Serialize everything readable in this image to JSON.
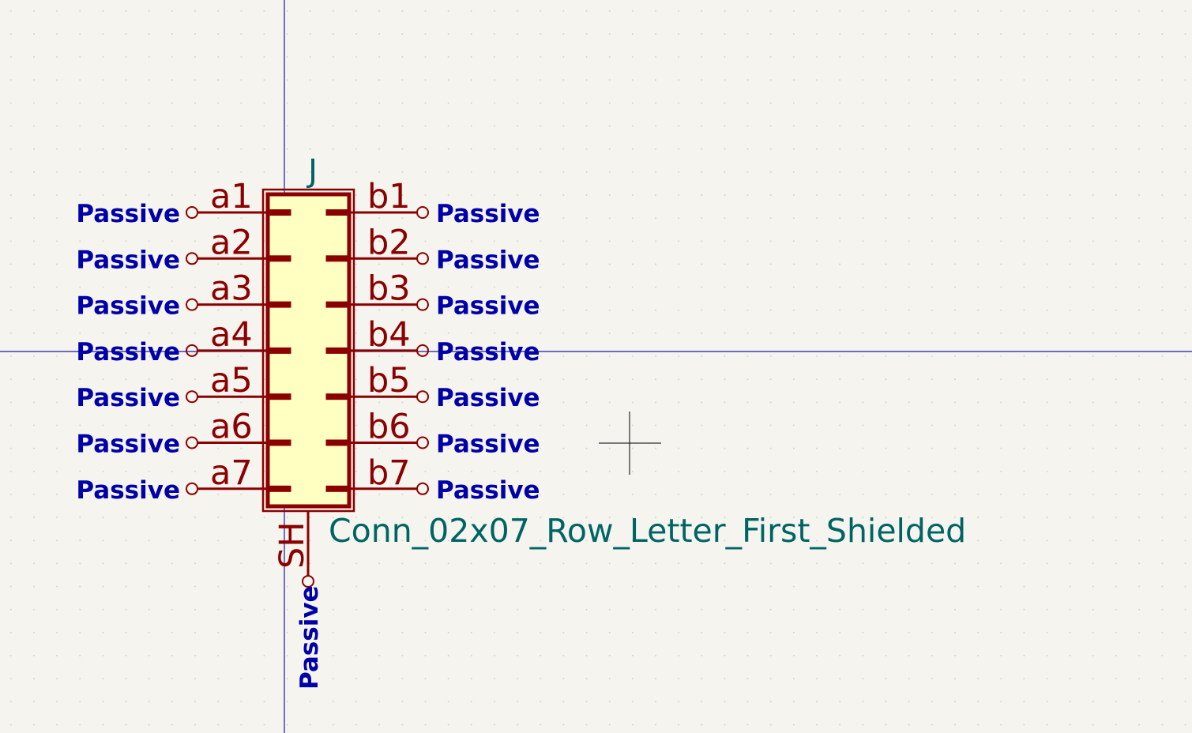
{
  "symbol": {
    "reference": "J",
    "value": "Conn_02x07_Row_Letter_First_Shielded",
    "body_fill": "#ffffc2",
    "outline_color": "#8b0000"
  },
  "left_pins": [
    {
      "name": "a1",
      "type": "Passive"
    },
    {
      "name": "a2",
      "type": "Passive"
    },
    {
      "name": "a3",
      "type": "Passive"
    },
    {
      "name": "a4",
      "type": "Passive"
    },
    {
      "name": "a5",
      "type": "Passive"
    },
    {
      "name": "a6",
      "type": "Passive"
    },
    {
      "name": "a7",
      "type": "Passive"
    }
  ],
  "right_pins": [
    {
      "name": "b1",
      "type": "Passive"
    },
    {
      "name": "b2",
      "type": "Passive"
    },
    {
      "name": "b3",
      "type": "Passive"
    },
    {
      "name": "b4",
      "type": "Passive"
    },
    {
      "name": "b5",
      "type": "Passive"
    },
    {
      "name": "b6",
      "type": "Passive"
    },
    {
      "name": "b7",
      "type": "Passive"
    }
  ],
  "bottom_pin": {
    "name": "SH",
    "type": "Passive"
  },
  "colors": {
    "background": "#f5f4ef",
    "grid_dot": "#c8c8c0",
    "axis": "#1a1aa0",
    "pin": "#8b0000",
    "pin_type": "#0000a8",
    "field_text": "#006464"
  }
}
